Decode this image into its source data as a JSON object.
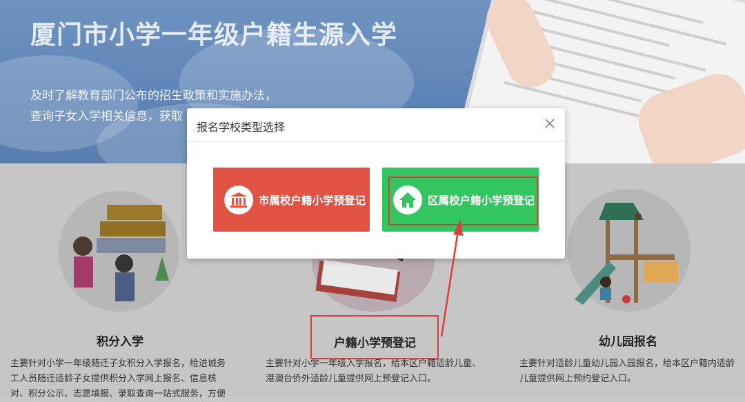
{
  "hero": {
    "title": "厦门市小学一年级户籍生源入学",
    "sub1": "及时了解教育部门公布的招生政策和实施办法，",
    "sub2": "查询子女入学相关信息，获取"
  },
  "cards": [
    {
      "title": "积分入学",
      "desc": "主要针对小学一年级随迁子女积分入学报名，给进城务工人员随迁适龄子女提供积分入学网上报名、信息核对、积分公示、志愿填报、录取查询一站式服务，方便"
    },
    {
      "title": "户籍小学预登记",
      "desc": "主要针对小学一年级入学报名，给本区户籍适龄儿童、港澳台侨外适龄儿童提供网上预登记入口。"
    },
    {
      "title": "幼儿园报名",
      "desc": "主要针对适龄儿童幼儿园入园报名，给本区户籍内适龄儿童提供网上预约登记入口。"
    }
  ],
  "modal": {
    "title": "报名学校类型选择",
    "close_icon": "close-icon",
    "options": [
      {
        "label": "市属校户籍小学预登记",
        "icon": "building-icon",
        "color": "#e05343"
      },
      {
        "label": "区属校户籍小学预登记",
        "icon": "home-icon",
        "color": "#33c660"
      }
    ]
  },
  "annotation_color": "#e23b3b"
}
